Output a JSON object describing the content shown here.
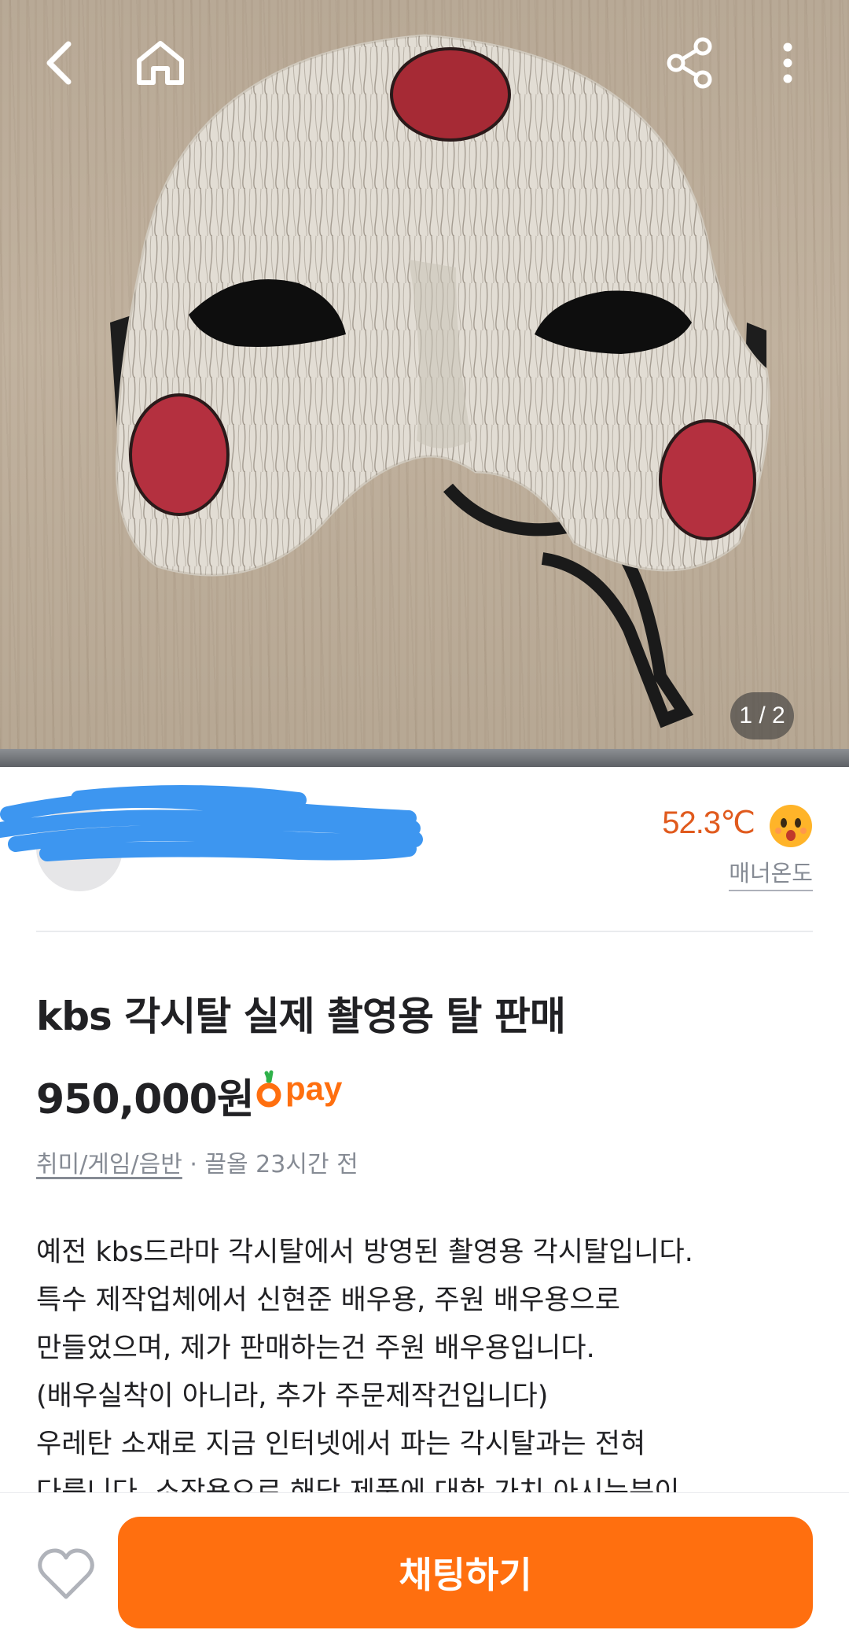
{
  "photo": {
    "counter": "1 / 2",
    "alt_subject": "white wooden mask with red circles"
  },
  "header": {
    "back_icon": "chevron-left-icon",
    "home_icon": "home-icon",
    "share_icon": "share-icon",
    "more_icon": "more-vertical-icon"
  },
  "seller": {
    "name": "",
    "location": "",
    "temperature": "52.3℃",
    "manner_label": "매너온도",
    "temperature_color": "#e05a1d"
  },
  "product": {
    "title": "kbs 각시탈 실제 촬영용 탈 판매",
    "price": "950,000원",
    "pay_label": "pay",
    "category": "취미/게임/음반",
    "bump_info": " · 끌올 23시간 전",
    "description": [
      "예전 kbs드라마 각시탈에서 방영된 촬영용 각시탈입니다.",
      "특수 제작업체에서 신현준 배우용, 주원 배우용으로",
      "만들었으며, 제가 판매하는건 주원 배우용입니다.",
      "(배우실착이 아니라, 추가 주문제작건입니다)",
      "우레탄 소재로 지금 인터넷에서 파는 각시탈과는 전혀",
      "다릅니다. 소장용으로 해당 제품에 대한 가치 아시는분이"
    ]
  },
  "actions": {
    "chat_label": "채팅하기",
    "accent_color": "#ff6f0f"
  }
}
